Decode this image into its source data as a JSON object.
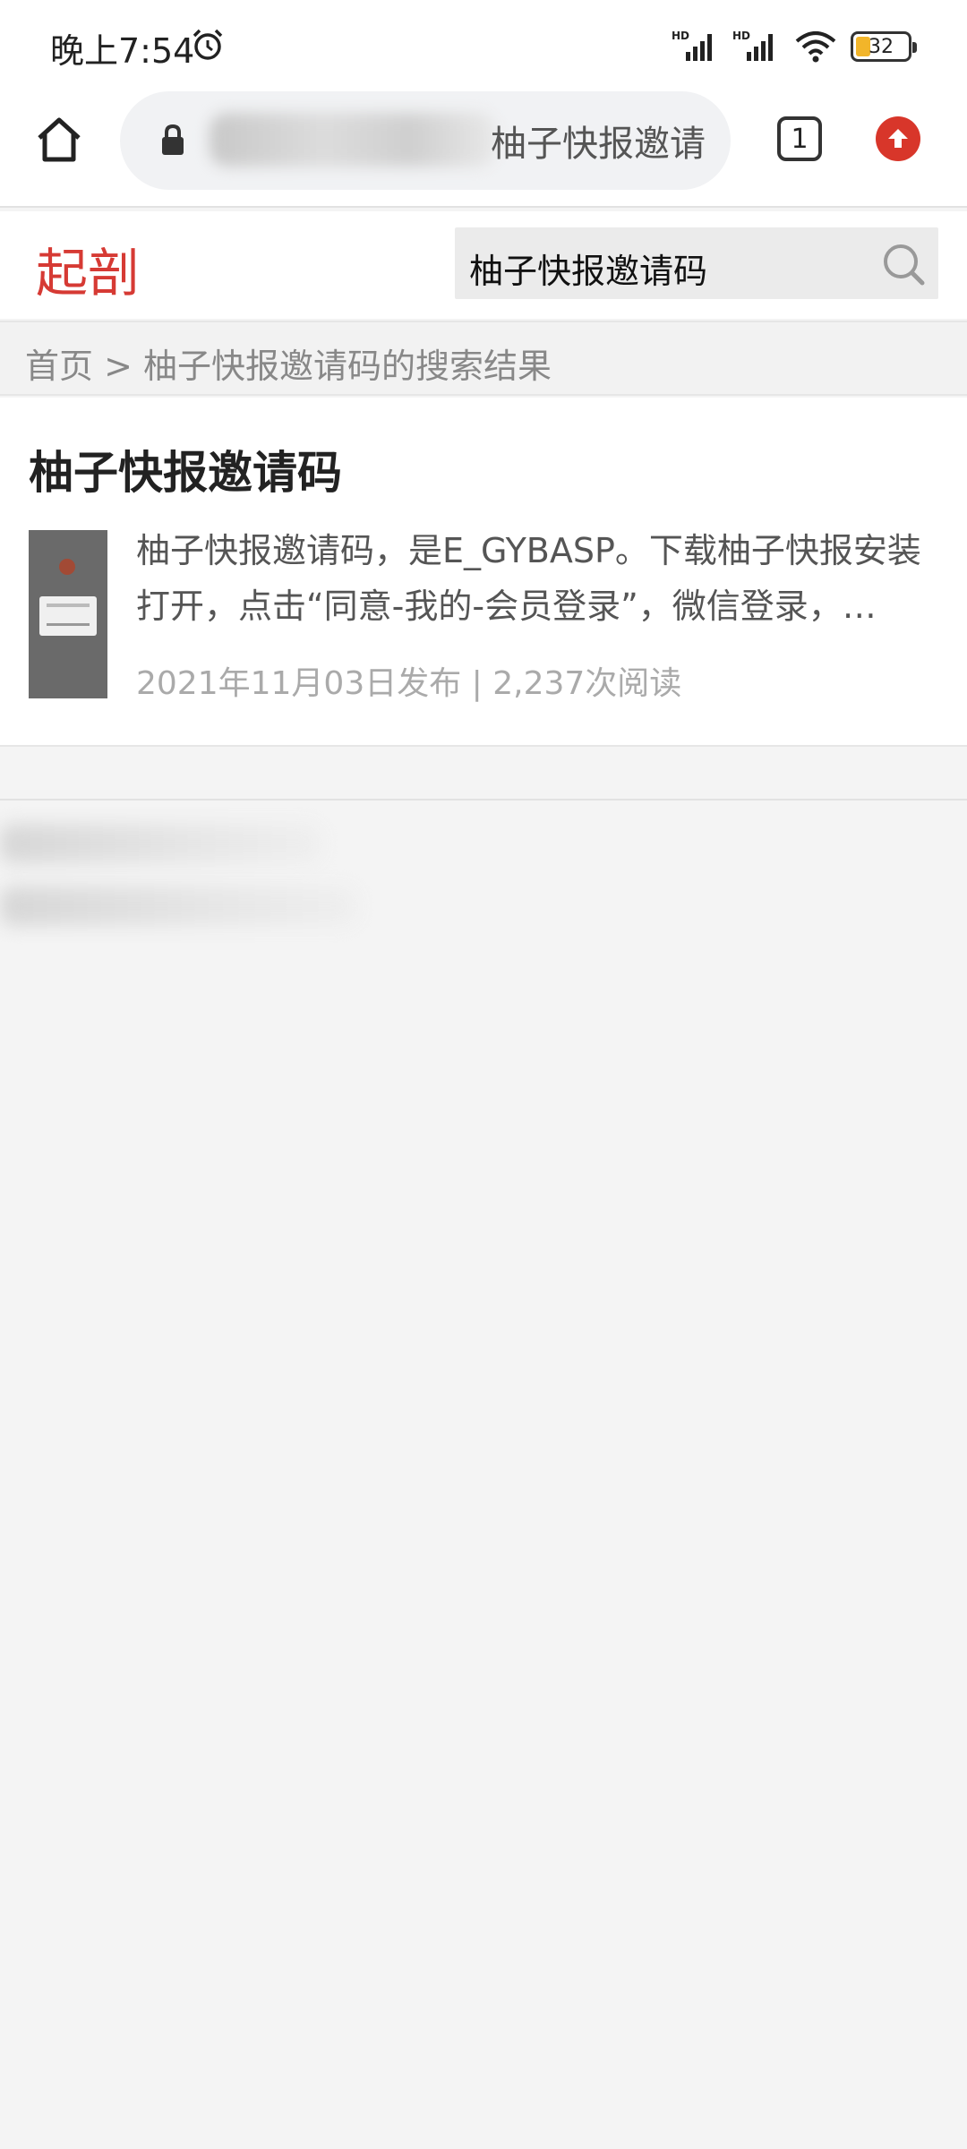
{
  "status_bar": {
    "time": "晚上7:54",
    "battery": "32",
    "icons": [
      "alarm-icon",
      "signal-icon",
      "signal-icon",
      "wifi-icon",
      "battery-icon"
    ],
    "colors": {
      "battery_fill": "#f2b52a"
    }
  },
  "browser": {
    "url_visible_text": "柚子快报邀请",
    "tab_count": "1",
    "colors": {
      "update_button": "#d8362a"
    }
  },
  "site": {
    "logo": "起剖",
    "search_value": "柚子快报邀请码",
    "colors": {
      "logo": "#d63a34"
    }
  },
  "breadcrumb": "首页 > 柚子快报邀请码的搜索结果",
  "results": [
    {
      "title": "柚子快报邀请码",
      "snippet": "柚子快报邀请码，是E_GYBASP。下载柚子快报安装打开，点击“同意-我的-会员登录”，微信登录，…",
      "meta": "2021年11月03日发布 | 2,237次阅读"
    }
  ]
}
